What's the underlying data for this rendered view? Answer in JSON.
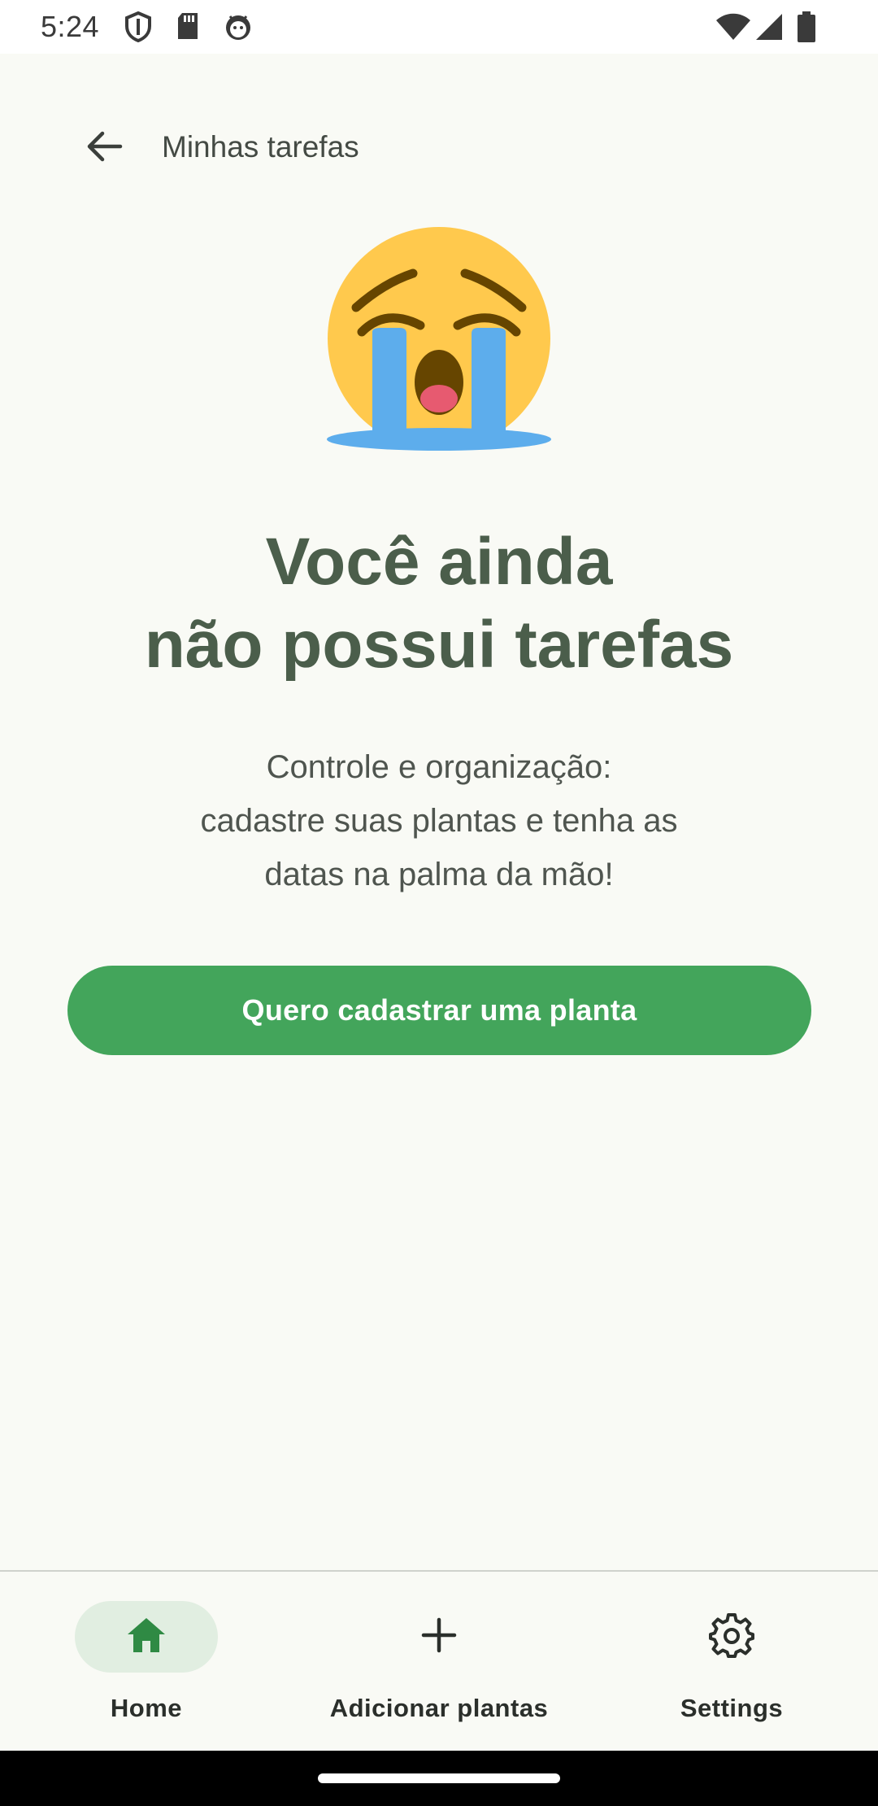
{
  "status_bar": {
    "time": "5:24",
    "icons": [
      "shield-icon",
      "sd-card-icon",
      "android-debug-icon",
      "wifi-icon",
      "signal-icon",
      "battery-icon"
    ]
  },
  "top_bar": {
    "back_icon": "arrow-back-icon",
    "title": "Minhas tarefas"
  },
  "empty_state": {
    "emoji": "loudly-crying-face",
    "headline_line1": "Você ainda",
    "headline_line2": "não possui tarefas",
    "body_line1": "Controle e organização:",
    "body_line2": "cadastre suas plantas e tenha as",
    "body_line3": "datas na palma da mão!",
    "cta_label": "Quero cadastrar uma planta"
  },
  "bottom_nav": {
    "items": [
      {
        "label": "Home",
        "icon": "home-icon",
        "active": true
      },
      {
        "label": "Adicionar plantas",
        "icon": "plus-icon",
        "active": false
      },
      {
        "label": "Settings",
        "icon": "gear-icon",
        "active": false
      }
    ]
  },
  "colors": {
    "background": "#f9faf5",
    "primary": "#43a55b",
    "headline": "#4b5e4b",
    "nav_active_pill": "#e1eee1"
  }
}
